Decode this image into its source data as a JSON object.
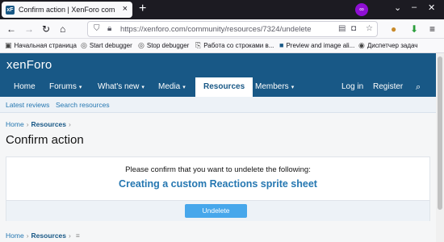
{
  "browser": {
    "tab_title": "Confirm action | XenForo com",
    "tab_favicon": "xF",
    "tab_close": "×",
    "new_tab": "+",
    "url": "https://xenforo.com/community/resources/7324/undelete",
    "bookmarks": [
      {
        "label": "Начальная страница",
        "icon": "page-icon"
      },
      {
        "label": "Start debugger",
        "icon": "globe-icon"
      },
      {
        "label": "Stop debugger",
        "icon": "globe-icon"
      },
      {
        "label": "Работа со строками в...",
        "icon": "bookmark-icon"
      },
      {
        "label": "Preview and image ali...",
        "icon": "xf-icon"
      },
      {
        "label": "Диспетчер задач",
        "icon": "github-icon"
      }
    ]
  },
  "site": {
    "logo": "xenForo",
    "nav": [
      {
        "label": "Home",
        "caret": ""
      },
      {
        "label": "Forums",
        "caret": "▾"
      },
      {
        "label": "What's new",
        "caret": "▾"
      },
      {
        "label": "Media",
        "caret": "▾"
      },
      {
        "label": "Resources",
        "caret": ""
      },
      {
        "label": "Members",
        "caret": "▾"
      }
    ],
    "login": "Log in",
    "register": "Register",
    "subnav": [
      "Latest reviews",
      "Search resources"
    ],
    "breadcrumb": {
      "home": "Home",
      "resources": "Resources"
    },
    "page_title": "Confirm action",
    "message": "Please confirm that you want to undelete the following:",
    "resource_title": "Creating a custom Reactions sprite sheet",
    "button": "Undelete",
    "colors": {
      "header": "#185886",
      "link": "#2577b1",
      "button": "#47a7eb"
    }
  }
}
